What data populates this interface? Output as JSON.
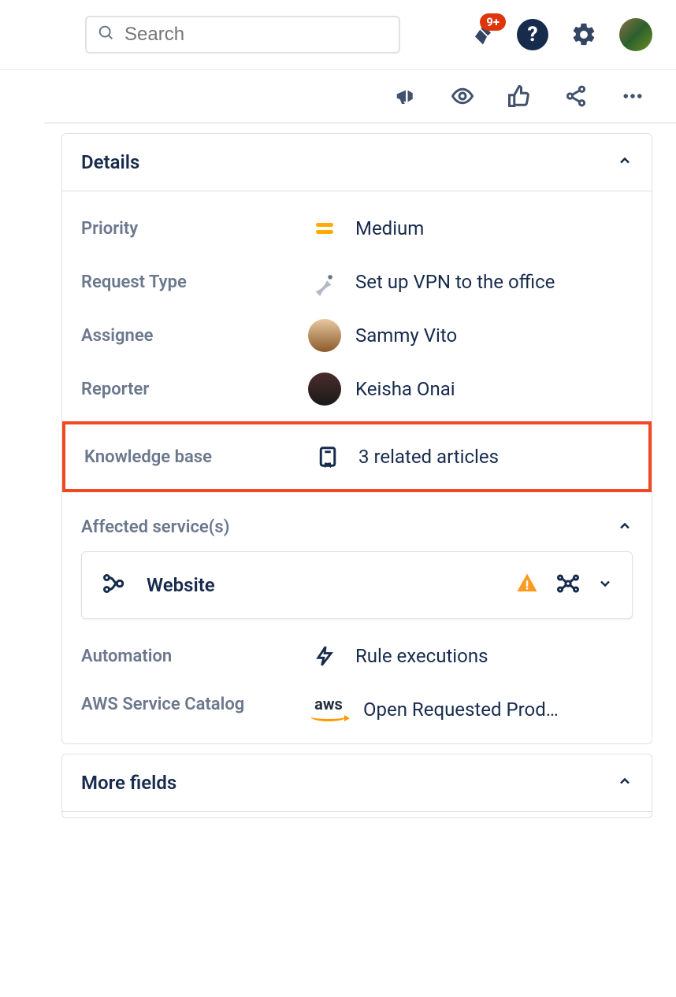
{
  "header": {
    "search_placeholder": "Search",
    "notification_badge": "9+"
  },
  "details": {
    "title": "Details",
    "fields": {
      "priority": {
        "label": "Priority",
        "value": "Medium"
      },
      "request_type": {
        "label": "Request Type",
        "value": "Set up VPN to the office"
      },
      "assignee": {
        "label": "Assignee",
        "value": "Sammy Vito"
      },
      "reporter": {
        "label": "Reporter",
        "value": "Keisha Onai"
      },
      "knowledge_base": {
        "label": "Knowledge base",
        "value": "3 related articles"
      },
      "affected_services": {
        "label": "Affected service(s)",
        "value": "Website"
      },
      "automation": {
        "label": "Automation",
        "value": "Rule executions"
      },
      "aws_catalog": {
        "label": "AWS Service Catalog",
        "value": "Open Requested Prod…"
      }
    }
  },
  "more_fields": {
    "title": "More fields"
  }
}
